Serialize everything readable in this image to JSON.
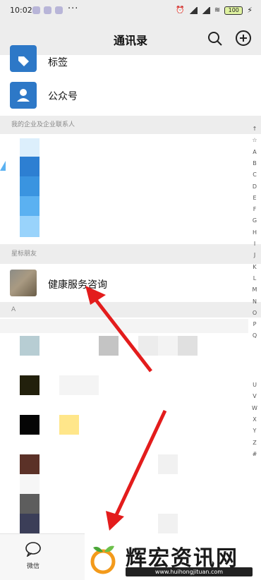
{
  "status_bar": {
    "time": "10:02",
    "more": "···",
    "battery": "100"
  },
  "header": {
    "title": "通讯录"
  },
  "rows": {
    "tags_label": "标签",
    "official_label": "公众号",
    "starred_contact_name": "健康服务咨询"
  },
  "sections": {
    "enterprise_header": "我的企业及企业联系人",
    "starred_header": "星标朋友",
    "a_header": "A"
  },
  "index_bar": {
    "letters_top": [
      "↑",
      "☆",
      "A",
      "B",
      "C",
      "D",
      "E",
      "F",
      "G",
      "H",
      "I",
      "J",
      "K",
      "L",
      "M",
      "N",
      "O",
      "P",
      "Q"
    ],
    "letters_bottom": [
      "U",
      "V",
      "W",
      "X",
      "Y",
      "Z",
      "#"
    ]
  },
  "tab_bar": {
    "wechat_label": "微信"
  },
  "watermark": {
    "text": "辉宏资讯网",
    "url": "www.huihongjituan.com"
  },
  "colors": {
    "brand_blue": "#2d78c7",
    "arrow_red": "#e31c1c",
    "bg_gray": "#ededed"
  }
}
